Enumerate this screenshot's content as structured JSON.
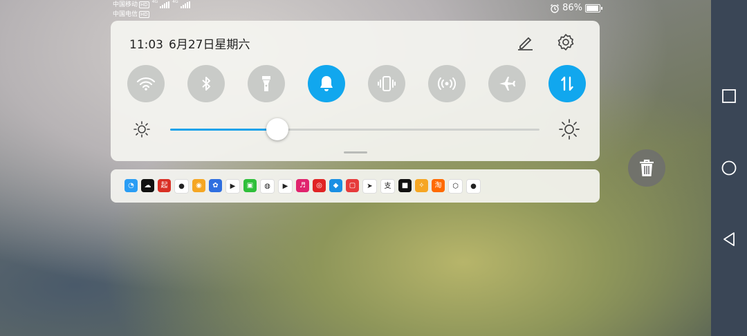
{
  "status_bar": {
    "carrier_1": "中国移动",
    "carrier_2": "中国电信",
    "hd_badge": "HD",
    "network_type": "4G",
    "battery_percent": "86%",
    "battery_level": 0.86,
    "alarm_icon": "alarm-clock-icon"
  },
  "quick_settings": {
    "time": "11:03",
    "date": "6月27日星期六",
    "edit_icon": "pencil-icon",
    "settings_icon": "gear-icon",
    "toggles": [
      {
        "id": "wifi",
        "icon": "wifi-icon",
        "on": false
      },
      {
        "id": "bluetooth",
        "icon": "bluetooth-icon",
        "on": false
      },
      {
        "id": "flashlight",
        "icon": "flashlight-icon",
        "on": false
      },
      {
        "id": "sound",
        "icon": "bell-icon",
        "on": true
      },
      {
        "id": "vibrate",
        "icon": "vibrate-icon",
        "on": false
      },
      {
        "id": "hotspot",
        "icon": "hotspot-icon",
        "on": false
      },
      {
        "id": "airplane",
        "icon": "airplane-icon",
        "on": false
      },
      {
        "id": "mobile-data",
        "icon": "mobile-data-icon",
        "on": true
      }
    ],
    "brightness_level": 0.29
  },
  "notification_apps": [
    {
      "name": "browser",
      "color": "#2a9df4",
      "glyph": "◔"
    },
    {
      "name": "cloud",
      "color": "#111111",
      "glyph": "☁"
    },
    {
      "name": "qidian",
      "color": "#d93025",
      "glyph": "起"
    },
    {
      "name": "wechat",
      "color": "#ffffff",
      "glyph": "●"
    },
    {
      "name": "weibo",
      "color": "#f5a623",
      "glyph": "◉"
    },
    {
      "name": "baidu",
      "color": "#2f6fe0",
      "glyph": "✿"
    },
    {
      "name": "video",
      "color": "#ffffff",
      "glyph": "▶"
    },
    {
      "name": "iqiyi",
      "color": "#2fbf3a",
      "glyph": "▣"
    },
    {
      "name": "globe",
      "color": "#ffffff",
      "glyph": "◍"
    },
    {
      "name": "youku",
      "color": "#ffffff",
      "glyph": "▶"
    },
    {
      "name": "music-store",
      "color": "#e0246e",
      "glyph": "♬"
    },
    {
      "name": "netease-music",
      "color": "#e02424",
      "glyph": "◎"
    },
    {
      "name": "app-blue",
      "color": "#1a8fe3",
      "glyph": "◆"
    },
    {
      "name": "reader",
      "color": "#e63b3b",
      "glyph": "▢"
    },
    {
      "name": "paper-plane",
      "color": "#ffffff",
      "glyph": "➤"
    },
    {
      "name": "alipay",
      "color": "#ffffff",
      "glyph": "支"
    },
    {
      "name": "dark-app",
      "color": "#111111",
      "glyph": "■"
    },
    {
      "name": "leaf",
      "color": "#f6a623",
      "glyph": "✧"
    },
    {
      "name": "taobao",
      "color": "#ff6a00",
      "glyph": "淘"
    },
    {
      "name": "hexagon",
      "color": "#ffffff",
      "glyph": "⬡"
    },
    {
      "name": "message",
      "color": "#ffffff",
      "glyph": "●"
    }
  ],
  "side_actions": {
    "trash_icon": "trash-icon"
  },
  "navigation": {
    "square_icon": "recent-apps-icon",
    "circle_icon": "home-icon",
    "triangle_icon": "back-icon"
  }
}
